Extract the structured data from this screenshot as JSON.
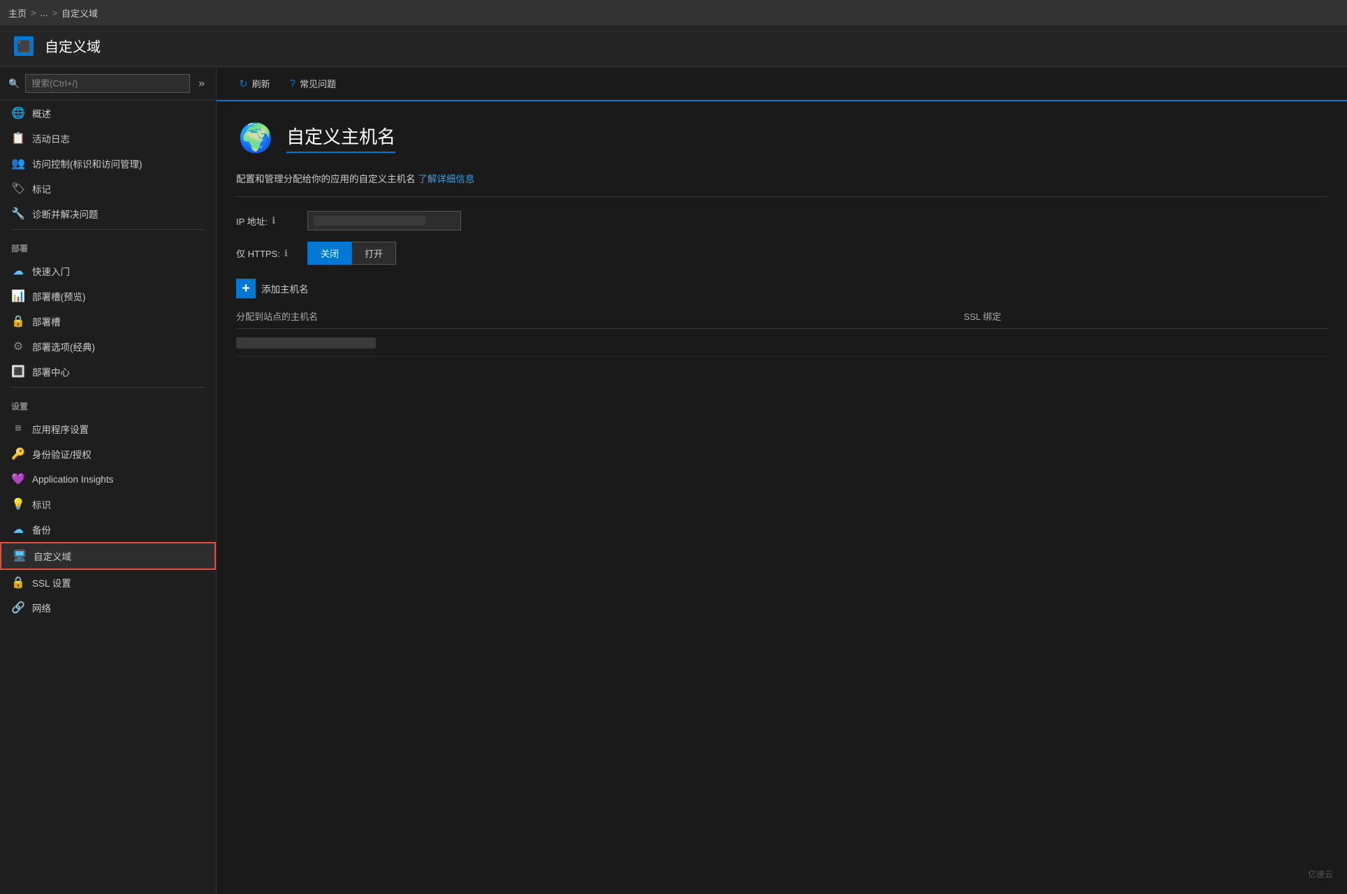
{
  "topbar": {
    "breadcrumb1": "主页",
    "sep1": ">",
    "breadcrumb2": "...",
    "sep2": ">",
    "breadcrumb3": "自定义域"
  },
  "header": {
    "title": "自定义域"
  },
  "sidebar": {
    "search_placeholder": "搜索(Ctrl+/)",
    "collapse_icon": "»",
    "items": [
      {
        "id": "overview",
        "label": "概述",
        "icon": "🌐"
      },
      {
        "id": "activity-log",
        "label": "活动日志",
        "icon": "📋"
      },
      {
        "id": "access-control",
        "label": "访问控制(标识和访问管理)",
        "icon": "👥"
      },
      {
        "id": "tags",
        "label": "标记",
        "icon": "🏷"
      },
      {
        "id": "diagnose",
        "label": "诊断并解决问题",
        "icon": "🔧"
      }
    ],
    "section_deploy": "部署",
    "deploy_items": [
      {
        "id": "quickstart",
        "label": "快速入门",
        "icon": "☁"
      },
      {
        "id": "deploy-slots-preview",
        "label": "部署槽(预览)",
        "icon": "📊"
      },
      {
        "id": "deploy-slots",
        "label": "部署槽",
        "icon": "🔒"
      },
      {
        "id": "deploy-options",
        "label": "部署选项(经典)",
        "icon": "⚙"
      },
      {
        "id": "deploy-center",
        "label": "部署中心",
        "icon": "🔳"
      }
    ],
    "section_settings": "设置",
    "settings_items": [
      {
        "id": "app-settings",
        "label": "应用程序设置",
        "icon": "≡"
      },
      {
        "id": "auth",
        "label": "身份验证/授权",
        "icon": "🔑"
      },
      {
        "id": "app-insights",
        "label": "Application Insights",
        "icon": "💜"
      },
      {
        "id": "identity",
        "label": "标识",
        "icon": "💡"
      },
      {
        "id": "backup",
        "label": "备份",
        "icon": "☁"
      },
      {
        "id": "custom-domain",
        "label": "自定义域",
        "icon": "🖥",
        "active": true
      },
      {
        "id": "ssl-settings",
        "label": "SSL 设置",
        "icon": "🔒"
      },
      {
        "id": "network",
        "label": "网络",
        "icon": "🔗"
      }
    ]
  },
  "toolbar": {
    "refresh_label": "刷新",
    "faq_label": "常见问题"
  },
  "main": {
    "page_icon": "🌍",
    "page_title": "自定义主机名",
    "description": "配置和管理分配给你的应用的自定义主机名",
    "description_link": "了解详细信息",
    "ip_label": "IP 地址:",
    "ip_value": "",
    "https_label": "仅 HTTPS:",
    "toggle_off": "关闭",
    "toggle_on": "打开",
    "add_hostname_label": "添加主机名",
    "table": {
      "col_hostname": "分配到站点的主机名",
      "col_ssl": "SSL 绑定",
      "rows": [
        {
          "hostname": "",
          "ssl": ""
        }
      ]
    }
  },
  "watermark": "亿速云"
}
